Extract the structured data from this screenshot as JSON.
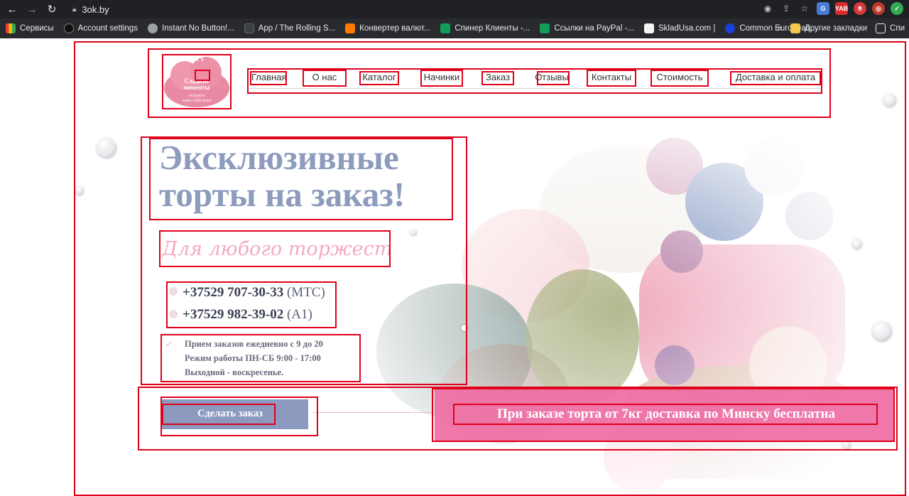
{
  "browser": {
    "url": "3ok.by",
    "bookmarks": [
      {
        "label": "Сервисы",
        "color": "#f4b400"
      },
      {
        "label": "Account settings",
        "color": "#24292f"
      },
      {
        "label": "Instant No Button!...",
        "color": "#9aa0a6"
      },
      {
        "label": "App / The Rolling S...",
        "color": "#3c4043"
      },
      {
        "label": "Конвертер валют...",
        "color": "#ff7a00"
      },
      {
        "label": "Спинер Клиенты -...",
        "color": "#0f9d58"
      },
      {
        "label": "Ссылки на PayPal -...",
        "color": "#0f9d58"
      },
      {
        "label": "SkladUsa.com |",
        "color": "#f5f5f5"
      },
      {
        "label": "Common European...",
        "color": "#1a3fd6"
      }
    ],
    "other_bookmarks": "Другие закладки",
    "reading_list": "Спи",
    "more_chevron": "»",
    "ext_yab": "YAB"
  },
  "site": {
    "logo": {
      "line1": "Сладкие",
      "line2": "моменты",
      "sub1": "exclusive",
      "sub2": "cakes collections"
    },
    "menu": [
      "Главная",
      "О нас",
      "Каталог",
      "Начинки",
      "Заказ",
      "Отзывы",
      "Контакты",
      "Стоимость",
      "Доставка и оплата"
    ],
    "headline_line1": "Эксклюзивные",
    "headline_line2": "торты на заказ!",
    "tagline": "Для любого торжества!",
    "phones": [
      {
        "number": "+37529 707-30-33",
        "operator": "(МТС)"
      },
      {
        "number": "+37529 982-39-02",
        "operator": "(А1)"
      }
    ],
    "hours": [
      "Прием заказов ежедневно с 9 до 20",
      "Режим работы ПН-СБ 9:00 - 17:00",
      "Выходной - воскресенье."
    ],
    "order_button": "Сделать заказ",
    "promo": "При заказе торта от 7кг доставка по Минску бесплатна"
  },
  "colors": {
    "highlight_boxes": "#e0001b",
    "headline": "#8d9bbd",
    "tagline": "#f4a9c3",
    "button": "#8c9ac0",
    "promo": "#ee6fa4"
  }
}
